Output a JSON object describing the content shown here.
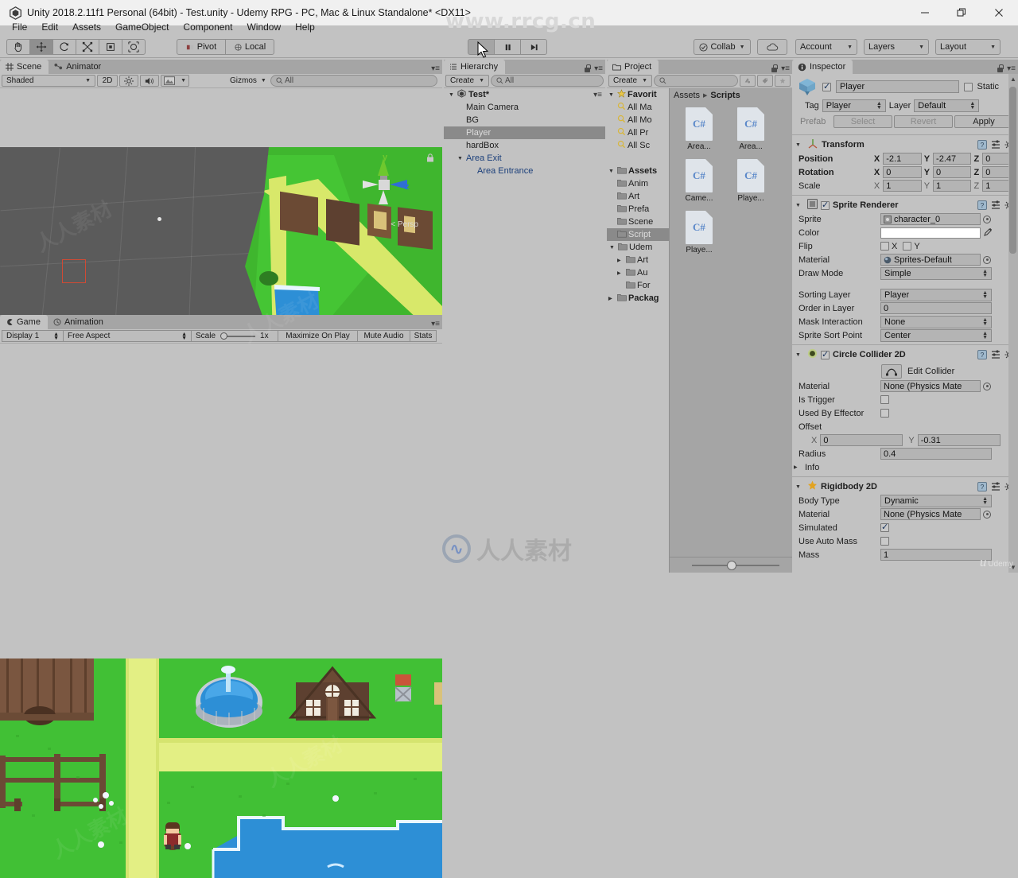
{
  "window": {
    "title": "Unity 2018.2.11f1 Personal (64bit) - Test.unity - Udemy RPG - PC, Mac & Linux Standalone* <DX11>",
    "minimize": "—",
    "restore": "❐",
    "close": "✕"
  },
  "watermarks": {
    "top": "www.rrcg.cn",
    "center": "人人素材",
    "corner_brand": "Udemy",
    "corner_mark": "u"
  },
  "menubar": {
    "items": [
      "File",
      "Edit",
      "Assets",
      "GameObject",
      "Component",
      "Window",
      "Help"
    ]
  },
  "toolbar": {
    "transform_tools": [
      {
        "name": "hand-tool",
        "glyph": "✋",
        "active": false
      },
      {
        "name": "move-tool",
        "glyph": "✥",
        "active": true
      },
      {
        "name": "rotate-tool",
        "glyph": "⟳",
        "active": false
      },
      {
        "name": "scale-tool",
        "glyph": "⤢",
        "active": false
      },
      {
        "name": "rect-tool",
        "glyph": "▣",
        "active": false
      },
      {
        "name": "transform-tool",
        "glyph": "✣",
        "active": false
      }
    ],
    "pivot_label": "Pivot",
    "local_label": "Local",
    "play_label": "▶",
    "pause_label": "❚❚",
    "step_label": "▶❙",
    "collab_label": "Collab",
    "cloud_label": "☁",
    "account_label": "Account",
    "layers_label": "Layers",
    "layout_label": "Layout"
  },
  "scene_panel": {
    "tabs": [
      {
        "label": "Scene",
        "icon": "grid-icon",
        "active": true
      },
      {
        "label": "Animator",
        "icon": "animator-icon",
        "active": false
      }
    ],
    "shading_mode": "Shaded",
    "mode_2d": "2D",
    "lighting_icon": "sun-icon",
    "audio_icon": "speaker-icon",
    "fx_icon": "image-icon",
    "gizmos_label": "Gizmos",
    "search_placeholder": "All",
    "gizmo_axes": {
      "y": "y",
      "z": "z"
    },
    "projection": "Persp"
  },
  "game_panel": {
    "tabs": [
      {
        "label": "Game",
        "icon": "game-icon",
        "active": true
      },
      {
        "label": "Animation",
        "icon": "clock-icon",
        "active": false
      }
    ],
    "display": "Display 1",
    "aspect": "Free Aspect",
    "scale_label": "Scale",
    "scale_value": "1x",
    "maximize_label": "Maximize On Play",
    "mute_label": "Mute Audio",
    "stats_label": "Stats"
  },
  "hierarchy": {
    "tab_label": "Hierarchy",
    "create_label": "Create",
    "search_placeholder": "All",
    "items": [
      {
        "label": "Test*",
        "depth": 0,
        "arrow": "▼",
        "selected": false,
        "prefab": false,
        "scene": true
      },
      {
        "label": "Main Camera",
        "depth": 1,
        "arrow": "",
        "selected": false,
        "prefab": false
      },
      {
        "label": "BG",
        "depth": 1,
        "arrow": "",
        "selected": false,
        "prefab": false
      },
      {
        "label": "Player",
        "depth": 1,
        "arrow": "",
        "selected": true,
        "prefab": false
      },
      {
        "label": "hardBox",
        "depth": 1,
        "arrow": "",
        "selected": false,
        "prefab": false
      },
      {
        "label": "Area Exit",
        "depth": 1,
        "arrow": "▼",
        "selected": false,
        "prefab": true
      },
      {
        "label": "Area Entrance",
        "depth": 2,
        "arrow": "",
        "selected": false,
        "prefab": true
      }
    ]
  },
  "project": {
    "tab_label": "Project",
    "create_label": "Create",
    "search_placeholder": "",
    "filter_icons": [
      "asset-filter-icon",
      "label-filter-icon",
      "favorite-filter-icon"
    ],
    "tree": [
      {
        "label": "Favorit",
        "depth": 0,
        "arrow": "▼",
        "icon": "star-icon",
        "bold": true,
        "selected": false
      },
      {
        "label": "All Ma",
        "depth": 1,
        "arrow": "",
        "icon": "search-icon",
        "bold": false,
        "selected": false
      },
      {
        "label": "All Mo",
        "depth": 1,
        "arrow": "",
        "icon": "search-icon",
        "bold": false,
        "selected": false
      },
      {
        "label": "All Pr",
        "depth": 1,
        "arrow": "",
        "icon": "search-icon",
        "bold": false,
        "selected": false
      },
      {
        "label": "All Sc",
        "depth": 1,
        "arrow": "",
        "icon": "search-icon",
        "bold": false,
        "selected": false
      },
      {
        "label": "",
        "depth": 0,
        "arrow": "",
        "icon": "",
        "bold": false,
        "selected": false
      },
      {
        "label": "Assets",
        "depth": 0,
        "arrow": "▼",
        "icon": "folder-icon",
        "bold": true,
        "selected": false
      },
      {
        "label": "Anim",
        "depth": 1,
        "arrow": "",
        "icon": "folder-icon",
        "bold": false,
        "selected": false
      },
      {
        "label": "Art",
        "depth": 1,
        "arrow": "",
        "icon": "folder-icon",
        "bold": false,
        "selected": false
      },
      {
        "label": "Prefa",
        "depth": 1,
        "arrow": "",
        "icon": "folder-icon",
        "bold": false,
        "selected": false
      },
      {
        "label": "Scene",
        "depth": 1,
        "arrow": "",
        "icon": "folder-icon",
        "bold": false,
        "selected": false
      },
      {
        "label": "Script",
        "depth": 1,
        "arrow": "",
        "icon": "folder-icon",
        "bold": false,
        "selected": true
      },
      {
        "label": "Udem",
        "depth": 1,
        "arrow": "▼",
        "icon": "folder-icon",
        "bold": false,
        "selected": false
      },
      {
        "label": "Art",
        "depth": 2,
        "arrow": "▶",
        "icon": "folder-icon",
        "bold": false,
        "selected": false
      },
      {
        "label": "Au",
        "depth": 2,
        "arrow": "▶",
        "icon": "folder-icon",
        "bold": false,
        "selected": false
      },
      {
        "label": "For",
        "depth": 2,
        "arrow": "",
        "icon": "folder-icon",
        "bold": false,
        "selected": false
      },
      {
        "label": "Packag",
        "depth": 0,
        "arrow": "▶",
        "icon": "folder-icon",
        "bold": true,
        "selected": false
      }
    ],
    "breadcrumb": [
      "Assets",
      "Scripts"
    ],
    "assets": [
      {
        "label": "Area...",
        "type": "C#"
      },
      {
        "label": "Area...",
        "type": "C#"
      },
      {
        "label": "Came...",
        "type": "C#"
      },
      {
        "label": "Playe...",
        "type": "C#"
      },
      {
        "label": "Playe...",
        "type": "C#"
      }
    ]
  },
  "inspector": {
    "tab_label": "Inspector",
    "object_name": "Player",
    "object_enabled": true,
    "static_label": "Static",
    "static_checked": false,
    "tag_label": "Tag",
    "tag_value": "Player",
    "layer_label": "Layer",
    "layer_value": "Default",
    "prefab_label": "Prefab",
    "select_label": "Select",
    "revert_label": "Revert",
    "apply_label": "Apply",
    "components": [
      {
        "name": "Transform",
        "icon": "transform-icon",
        "has_checkbox": false,
        "rows": [
          {
            "label": "Position",
            "bold": true,
            "type": "vec3",
            "x": "-2.1",
            "y": "-2.47",
            "z": "0"
          },
          {
            "label": "Rotation",
            "bold": true,
            "type": "vec3",
            "x": "0",
            "y": "0",
            "z": "0"
          },
          {
            "label": "Scale",
            "bold": false,
            "type": "vec3",
            "x": "1",
            "y": "1",
            "z": "1"
          }
        ]
      },
      {
        "name": "Sprite Renderer",
        "icon": "sprite-renderer-icon",
        "has_checkbox": true,
        "checked": true,
        "rows": [
          {
            "label": "Sprite",
            "type": "object",
            "value": "character_0"
          },
          {
            "label": "Color",
            "type": "color",
            "value": "#ffffff"
          },
          {
            "label": "Flip",
            "type": "flip",
            "x_label": "X",
            "y_label": "Y",
            "x": false,
            "y": false
          },
          {
            "label": "Material",
            "type": "object",
            "value": "Sprites-Default"
          },
          {
            "label": "Draw Mode",
            "type": "popup",
            "value": "Simple"
          },
          {
            "label": "",
            "type": "spacer"
          },
          {
            "label": "Sorting Layer",
            "type": "popup",
            "value": "Player"
          },
          {
            "label": "Order in Layer",
            "type": "text",
            "value": "0"
          },
          {
            "label": "Mask Interaction",
            "type": "popup",
            "value": "None"
          },
          {
            "label": "Sprite Sort Point",
            "type": "popup",
            "value": "Center"
          }
        ]
      },
      {
        "name": "Circle Collider 2D",
        "icon": "circle-collider-icon",
        "has_checkbox": true,
        "checked": true,
        "edit_collider_label": "Edit Collider",
        "rows": [
          {
            "label": "Material",
            "type": "object",
            "value": "None (Physics Mate"
          },
          {
            "label": "Is Trigger",
            "type": "check",
            "checked": false
          },
          {
            "label": "Used By Effector",
            "type": "check",
            "checked": false
          },
          {
            "label": "Offset",
            "type": "label"
          },
          {
            "label": "",
            "type": "vec2",
            "x": "0",
            "y": "-0.31"
          },
          {
            "label": "Radius",
            "type": "text",
            "value": "0.4"
          },
          {
            "label": "Info",
            "type": "foldout"
          }
        ]
      },
      {
        "name": "Rigidbody 2D",
        "icon": "rigidbody-icon",
        "has_checkbox": false,
        "rows": [
          {
            "label": "Body Type",
            "type": "popup",
            "value": "Dynamic"
          },
          {
            "label": "Material",
            "type": "object",
            "value": "None (Physics Mate"
          },
          {
            "label": "Simulated",
            "type": "check",
            "checked": true
          },
          {
            "label": "Use Auto Mass",
            "type": "check",
            "checked": false
          },
          {
            "label": "Mass",
            "type": "text",
            "value": "1"
          }
        ]
      }
    ]
  }
}
